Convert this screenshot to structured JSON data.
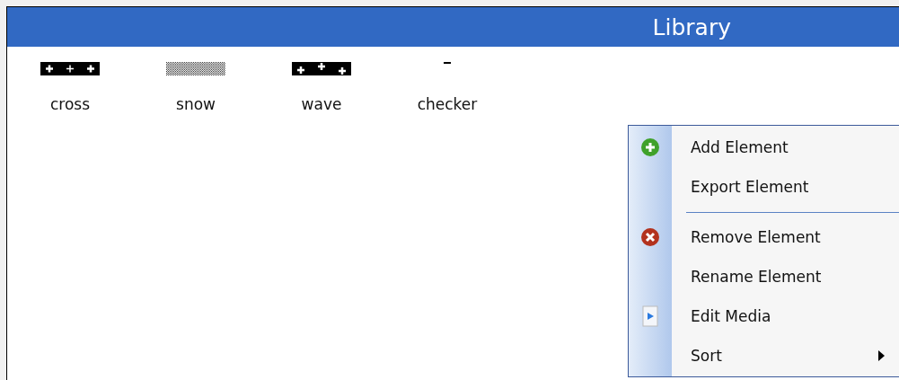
{
  "panel": {
    "title": "Library"
  },
  "elements": [
    {
      "label": "cross",
      "kind": "cross"
    },
    {
      "label": "snow",
      "kind": "snow"
    },
    {
      "label": "wave",
      "kind": "wave"
    },
    {
      "label": "checker",
      "kind": "checker"
    }
  ],
  "context_menu": {
    "items": [
      {
        "kind": "add",
        "label": "Add Element"
      },
      {
        "kind": "plain",
        "label": "Export Element"
      },
      {
        "kind": "separator"
      },
      {
        "kind": "remove",
        "label": "Remove Element"
      },
      {
        "kind": "plain",
        "label": "Rename Element"
      },
      {
        "kind": "media",
        "label": "Edit Media"
      },
      {
        "kind": "submenu",
        "label": "Sort"
      }
    ]
  }
}
